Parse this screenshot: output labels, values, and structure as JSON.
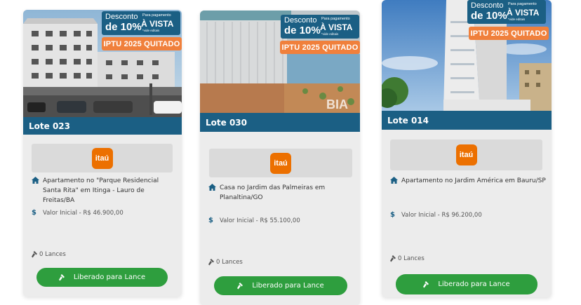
{
  "colors": {
    "header_blue": "#1b5f84",
    "iptu_orange": "#f0803c",
    "button_green": "#2e9e3e",
    "itau_orange": "#ec7000"
  },
  "cards": [
    {
      "discount": {
        "prefix": "Desconto",
        "pct": "de 10%",
        "small": "Para pagamento",
        "vista": "À VISTA",
        "note": "*vide editais"
      },
      "iptu": "IPTU 2025 QUITADO",
      "lote": "Lote 023",
      "bank": "itaú",
      "description": "Apartamento no \"Parque Residencial Santa Rita\" em Itinga - Lauro de Freitas/BA",
      "valor": "Valor Inicial - R$ 46.900,00",
      "lances": "0 Lances",
      "button": "Liberado para Lance"
    },
    {
      "discount": {
        "prefix": "Desconto",
        "pct": "de 10%",
        "small": "Para pagamento",
        "vista": "À VISTA",
        "note": "*vide editais"
      },
      "iptu": "IPTU 2025 QUITADO",
      "lote": "Lote 030",
      "bank": "itaú",
      "watermark": "BIA",
      "description": "Casa no Jardim das Palmeiras em Planaltina/GO",
      "valor": "Valor Inicial - R$ 55.100,00",
      "lances": "0 Lances",
      "button": "Liberado para Lance"
    },
    {
      "discount": {
        "prefix": "Desconto",
        "pct": "de 10%",
        "small": "Para pagamento",
        "vista": "À VISTA",
        "note": "*vide editais"
      },
      "iptu": "IPTU 2025 QUITADO",
      "lote": "Lote 014",
      "bank": "itaú",
      "description": "Apartamento no Jardim América em Bauru/SP",
      "valor": "Valor Inicial - R$ 96.200,00",
      "lances": "0 Lances",
      "button": "Liberado para Lance"
    }
  ]
}
